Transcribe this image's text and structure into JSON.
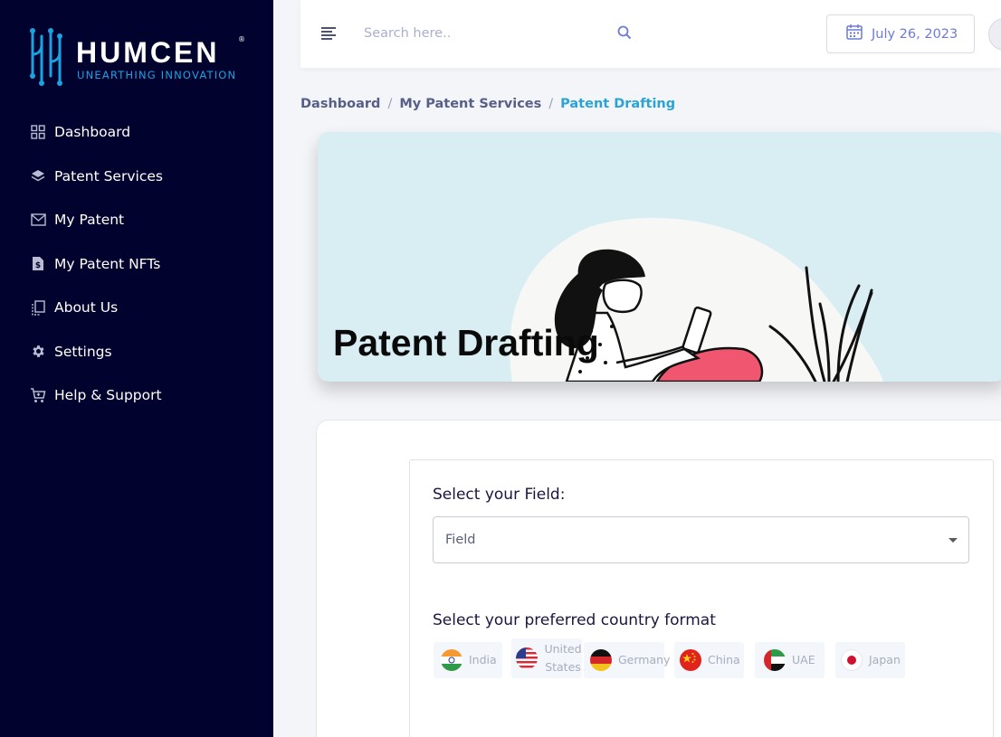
{
  "brand": {
    "name": "HUMCEN",
    "tagline": "UNEARTHING INNOVATION",
    "registered_mark": "®"
  },
  "sidebar": {
    "items": [
      {
        "label": "Dashboard",
        "icon": "grid-icon"
      },
      {
        "label": "Patent Services",
        "icon": "layers-icon"
      },
      {
        "label": "My Patent",
        "icon": "envelope-icon"
      },
      {
        "label": "My Patent NFTs",
        "icon": "dollar-file-icon"
      },
      {
        "label": "About Us",
        "icon": "copy-icon"
      },
      {
        "label": "Settings",
        "icon": "gear-icon"
      },
      {
        "label": "Help & Support",
        "icon": "cart-icon"
      }
    ]
  },
  "topbar": {
    "search_placeholder": "Search here..",
    "date": "July 26, 2023"
  },
  "breadcrumb": [
    "Dashboard",
    "My Patent Services",
    "Patent Drafting"
  ],
  "hero": {
    "title": "Patent Drafting"
  },
  "form": {
    "field_label": "Select your Field:",
    "field_value": "Field",
    "country_label": "Select your preferred country format",
    "countries": [
      {
        "name": "India",
        "flag": "india-flag-icon"
      },
      {
        "name_line1": "United",
        "name_line2": "States",
        "flag": "usa-flag-icon"
      },
      {
        "name": "Germany",
        "flag": "germany-flag-icon"
      },
      {
        "name": "China",
        "flag": "china-flag-icon"
      },
      {
        "name": "UAE",
        "flag": "uae-flag-icon"
      },
      {
        "name": "Japan",
        "flag": "japan-flag-icon"
      }
    ]
  },
  "colors": {
    "sidebar_bg": "#02022e",
    "brand_blue": "#1aa3e0",
    "breadcrumb_active": "#2aa3d8",
    "hero_bg": "#d9eef3",
    "accent_pink": "#f0566f"
  }
}
